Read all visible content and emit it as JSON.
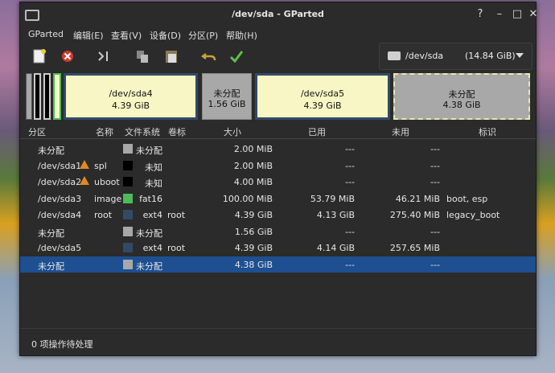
{
  "window": {
    "title": "/dev/sda - GParted"
  },
  "menu": [
    "GParted",
    "编辑(E)",
    "查看(V)",
    "设备(D)",
    "分区(P)",
    "帮助(H)"
  ],
  "toolbar_icons": [
    "new-icon",
    "delete-icon",
    "resize-move-icon",
    "copy-icon",
    "paste-icon",
    "undo-icon",
    "apply-icon"
  ],
  "device": {
    "name": "/dev/sda",
    "size": "(14.84 GiB)"
  },
  "map": [
    {
      "name": "/dev/sda4",
      "size": "4.39 GiB"
    },
    {
      "name": "未分配",
      "size": "1.56 GiB"
    },
    {
      "name": "/dev/sda5",
      "size": "4.39 GiB"
    },
    {
      "name": "未分配",
      "size": "4.38 GiB"
    }
  ],
  "columns": [
    "分区",
    "名称",
    "文件系统",
    "卷标",
    "大小",
    "已用",
    "未用",
    "标识"
  ],
  "rows": [
    {
      "partition": "未分配",
      "name": "",
      "fs": "未分配",
      "label": "",
      "size": "2.00 MiB",
      "used": "---",
      "unused": "---",
      "flags": "",
      "color": "#a8a8a8",
      "warn": false
    },
    {
      "partition": "/dev/sda1",
      "name": "spl",
      "fs": "未知",
      "label": "",
      "size": "2.00 MiB",
      "used": "---",
      "unused": "---",
      "flags": "",
      "color": "#000000",
      "warn": true
    },
    {
      "partition": "/dev/sda2",
      "name": "uboot",
      "fs": "未知",
      "label": "",
      "size": "4.00 MiB",
      "used": "---",
      "unused": "---",
      "flags": "",
      "color": "#000000",
      "warn": true
    },
    {
      "partition": "/dev/sda3",
      "name": "image",
      "fs": "fat16",
      "label": "",
      "size": "100.00 MiB",
      "used": "53.79 MiB",
      "unused": "46.21 MiB",
      "flags": "boot, esp",
      "color": "#4cbb5a",
      "warn": false
    },
    {
      "partition": "/dev/sda4",
      "name": "root",
      "fs": "ext4",
      "label": "root",
      "size": "4.39 GiB",
      "used": "4.13 GiB",
      "unused": "275.40 MiB",
      "flags": "legacy_boot",
      "color": "#314a66",
      "warn": false
    },
    {
      "partition": "未分配",
      "name": "",
      "fs": "未分配",
      "label": "",
      "size": "1.56 GiB",
      "used": "---",
      "unused": "---",
      "flags": "",
      "color": "#a8a8a8",
      "warn": false
    },
    {
      "partition": "/dev/sda5",
      "name": "",
      "fs": "ext4",
      "label": "root",
      "size": "4.39 GiB",
      "used": "4.14 GiB",
      "unused": "257.65 MiB",
      "flags": "",
      "color": "#314a66",
      "warn": false
    },
    {
      "partition": "未分配",
      "name": "",
      "fs": "未分配",
      "label": "",
      "size": "4.38 GiB",
      "used": "---",
      "unused": "---",
      "flags": "",
      "color": "#a8a8a8",
      "warn": false,
      "selected": true
    }
  ],
  "status": "0 项操作待处理"
}
